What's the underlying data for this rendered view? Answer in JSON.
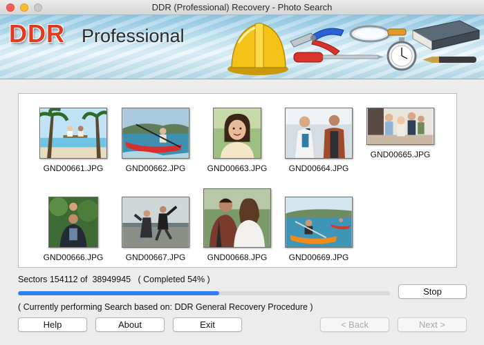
{
  "window": {
    "title": "DDR (Professional) Recovery - Photo Search"
  },
  "banner": {
    "logo_main": "DDR",
    "logo_sub": "Professional"
  },
  "photos": [
    {
      "name": "GND00661.JPG"
    },
    {
      "name": "GND00662.JPG"
    },
    {
      "name": "GND00663.JPG"
    },
    {
      "name": "GND00664.JPG"
    },
    {
      "name": "GND00665.JPG"
    },
    {
      "name": "GND00666.JPG"
    },
    {
      "name": "GND00667.JPG"
    },
    {
      "name": "GND00668.JPG"
    },
    {
      "name": "GND00669.JPG"
    }
  ],
  "status": {
    "text": "Sectors 154112 of  38949945   ( Completed 54% )",
    "progress_percent": 54,
    "activity": "( Currently performing Search based on: DDR General Recovery Procedure )"
  },
  "buttons": {
    "stop": "Stop",
    "help": "Help",
    "about": "About",
    "exit": "Exit",
    "back": "< Back",
    "next": "Next >"
  },
  "colors": {
    "accent": "#2f7ff3",
    "logo_red": "#e23a1f"
  }
}
